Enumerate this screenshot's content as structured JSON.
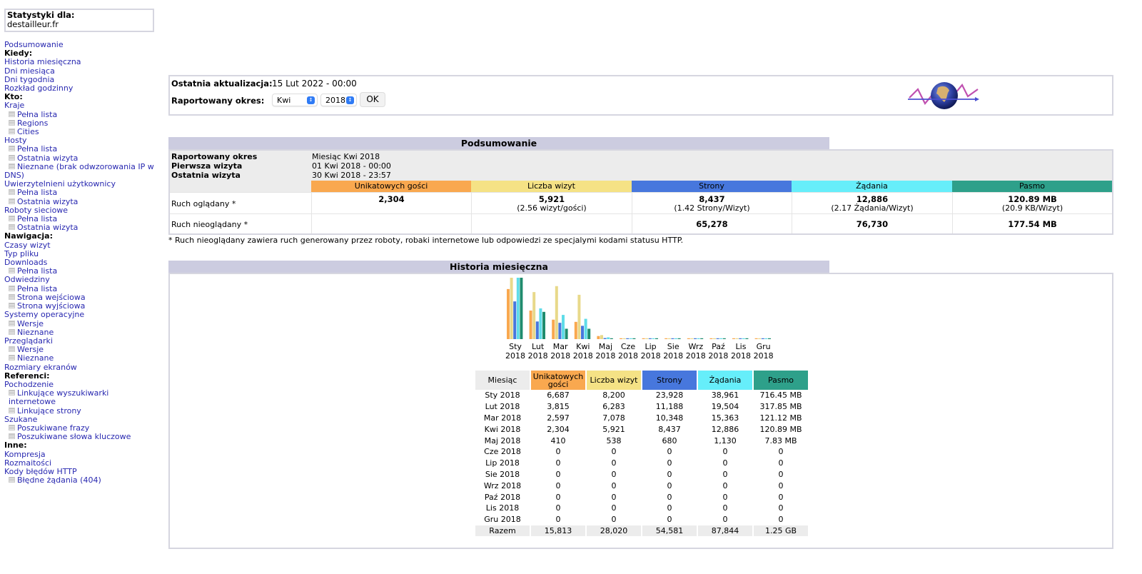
{
  "site": {
    "label": "Statystyki dla:",
    "domain": "destailleur.fr"
  },
  "menu": {
    "summary": "Podsumowanie",
    "when": {
      "header": "Kiedy:",
      "items": [
        "Historia miesięczna",
        "Dni miesiąca",
        "Dni tygodnia",
        "Rozkład godzinny"
      ]
    },
    "who": {
      "header": "Kto:",
      "countries": "Kraje",
      "countries_sub": [
        "Pełna lista",
        "Regions",
        "Cities"
      ],
      "hosts": "Hosty",
      "hosts_sub": [
        "Pełna lista",
        "Ostatnia wizyta",
        "Nieznane (brak odwzorowania IP w",
        "DNS)"
      ],
      "auth": "Uwierzytelnieni użytkownicy",
      "auth_sub": [
        "Pełna lista",
        "Ostatnia wizyta"
      ],
      "robots": "Roboty sieciowe",
      "robots_sub": [
        "Pełna lista",
        "Ostatnia wizyta"
      ]
    },
    "nav": {
      "header": "Nawigacja:",
      "visit_times": "Czasy wizyt",
      "file_type": "Typ pliku",
      "downloads": "Downloads",
      "downloads_sub": [
        "Pełna lista"
      ],
      "visits": "Odwiedziny",
      "visits_sub": [
        "Pełna lista",
        "Strona wejściowa",
        "Strona wyjściowa"
      ],
      "os": "Systemy operacyjne",
      "os_sub": [
        "Wersje",
        "Nieznane"
      ],
      "browsers": "Przeglądarki",
      "browsers_sub": [
        "Wersje",
        "Nieznane"
      ],
      "screen": "Rozmiary ekranów"
    },
    "ref": {
      "header": "Referenci:",
      "origin": "Pochodzenie",
      "origin_sub": [
        "Linkujące wyszukiwarki internetowe",
        "Linkujące strony"
      ],
      "search": "Szukane",
      "search_sub": [
        "Poszukiwane frazy",
        "Poszukiwane słowa kluczowe"
      ]
    },
    "other": {
      "header": "Inne:",
      "items": [
        "Kompresja",
        "Rozmaitości",
        "Kody błędów HTTP"
      ],
      "errors_sub": [
        "Błędne żądania (404)"
      ]
    }
  },
  "top": {
    "updated_label": "Ostatnia aktualizacja:",
    "updated_value": "15 Lut 2022 - 00:00",
    "period_label": "Raportowany okres:",
    "month_selected": "Kwi",
    "year_selected": "2018",
    "ok_label": "OK"
  },
  "summary": {
    "title": "Podsumowanie",
    "info": [
      {
        "label": "Raportowany okres",
        "value": "Miesiąc Kwi 2018"
      },
      {
        "label": "Pierwsza wizyta",
        "value": "01 Kwi 2018 - 00:00"
      },
      {
        "label": "Ostatnia wizyta",
        "value": "30 Kwi 2018 - 23:57"
      }
    ],
    "columns": [
      "Unikatowych gości",
      "Liczba wizyt",
      "Strony",
      "Żądania",
      "Pasmo"
    ],
    "viewed": {
      "label": "Ruch oglądany *",
      "values": [
        "2,304",
        "5,921",
        "8,437",
        "12,886",
        "120.89 MB"
      ],
      "sub": [
        "",
        "(2.56 wizyt/gości)",
        "(1.42 Strony/Wizyt)",
        "(2.17 Żądania/Wizyt)",
        "(20.9 KB/Wizyt)"
      ]
    },
    "not_viewed": {
      "label": "Ruch nieoglądany *",
      "values": [
        "",
        "",
        "65,278",
        "76,730",
        "177.54 MB"
      ]
    },
    "footnote": "* Ruch nieoglądany zawiera ruch generowany przez roboty, robaki internetowe lub odpowiedzi ze specjalymi kodami statusu HTTP."
  },
  "colors": {
    "visitors": "#f9a84f",
    "visits": "#f5e285",
    "pages": "#4777dd",
    "hits": "#66eefa",
    "bandwidth": "#2ea08a",
    "header_bg": "#cccce0",
    "link": "#2828b0"
  },
  "history": {
    "title": "Historia miesięczna",
    "table_headers": [
      "Miesiąc",
      "Unikatowych gości",
      "Liczba wizyt",
      "Strony",
      "Żądania",
      "Pasmo"
    ],
    "rows": [
      [
        "Sty 2018",
        "6,687",
        "8,200",
        "23,928",
        "38,961",
        "716.45 MB"
      ],
      [
        "Lut 2018",
        "3,815",
        "6,283",
        "11,188",
        "19,504",
        "317.85 MB"
      ],
      [
        "Mar 2018",
        "2,597",
        "7,078",
        "10,348",
        "15,363",
        "121.12 MB"
      ],
      [
        "Kwi 2018",
        "2,304",
        "5,921",
        "8,437",
        "12,886",
        "120.89 MB"
      ],
      [
        "Maj 2018",
        "410",
        "538",
        "680",
        "1,130",
        "7.83 MB"
      ],
      [
        "Cze 2018",
        "0",
        "0",
        "0",
        "0",
        "0"
      ],
      [
        "Lip 2018",
        "0",
        "0",
        "0",
        "0",
        "0"
      ],
      [
        "Sie 2018",
        "0",
        "0",
        "0",
        "0",
        "0"
      ],
      [
        "Wrz 2018",
        "0",
        "0",
        "0",
        "0",
        "0"
      ],
      [
        "Paź 2018",
        "0",
        "0",
        "0",
        "0",
        "0"
      ],
      [
        "Lis 2018",
        "0",
        "0",
        "0",
        "0",
        "0"
      ],
      [
        "Gru 2018",
        "0",
        "0",
        "0",
        "0",
        "0"
      ]
    ],
    "total": [
      "Razem",
      "15,813",
      "28,020",
      "54,581",
      "87,844",
      "1.25 GB"
    ]
  },
  "chart_data": {
    "type": "bar",
    "title": "Historia miesięczna",
    "categories": [
      "Sty 2018",
      "Lut 2018",
      "Mar 2018",
      "Kwi 2018",
      "Maj 2018",
      "Cze 2018",
      "Lip 2018",
      "Sie 2018",
      "Wrz 2018",
      "Paź 2018",
      "Lis 2018",
      "Gru 2018"
    ],
    "category_labels": [
      [
        "Sty",
        "2018"
      ],
      [
        "Lut",
        "2018"
      ],
      [
        "Mar",
        "2018"
      ],
      [
        "Kwi",
        "2018"
      ],
      [
        "Maj",
        "2018"
      ],
      [
        "Cze",
        "2018"
      ],
      [
        "Lip",
        "2018"
      ],
      [
        "Sie",
        "2018"
      ],
      [
        "Wrz",
        "2018"
      ],
      [
        "Paź",
        "2018"
      ],
      [
        "Lis",
        "2018"
      ],
      [
        "Gru",
        "2018"
      ]
    ],
    "series": [
      {
        "name": "Unikatowych gości",
        "color": "#f9a84f",
        "values": [
          6687,
          3815,
          2597,
          2304,
          410,
          0,
          0,
          0,
          0,
          0,
          0,
          0
        ]
      },
      {
        "name": "Liczba wizyt",
        "color": "#e8d98a",
        "values": [
          8200,
          6283,
          7078,
          5921,
          538,
          0,
          0,
          0,
          0,
          0,
          0,
          0
        ]
      },
      {
        "name": "Strony",
        "color": "#4777dd",
        "values": [
          23928,
          11188,
          10348,
          8437,
          680,
          0,
          0,
          0,
          0,
          0,
          0,
          0
        ]
      },
      {
        "name": "Żądania",
        "color": "#5fdce8",
        "values": [
          38961,
          19504,
          15363,
          12886,
          1130,
          0,
          0,
          0,
          0,
          0,
          0,
          0
        ]
      },
      {
        "name": "Pasmo (MB)",
        "color": "#1f8c6e",
        "values": [
          716.45,
          317.85,
          121.12,
          120.89,
          7.83,
          0,
          0,
          0,
          0,
          0,
          0,
          0
        ]
      }
    ],
    "scale_groups": [
      [
        0,
        1
      ],
      [
        2,
        3
      ],
      [
        4
      ]
    ],
    "xlabel": "",
    "ylabel": "",
    "grid": false,
    "legend": "none"
  }
}
